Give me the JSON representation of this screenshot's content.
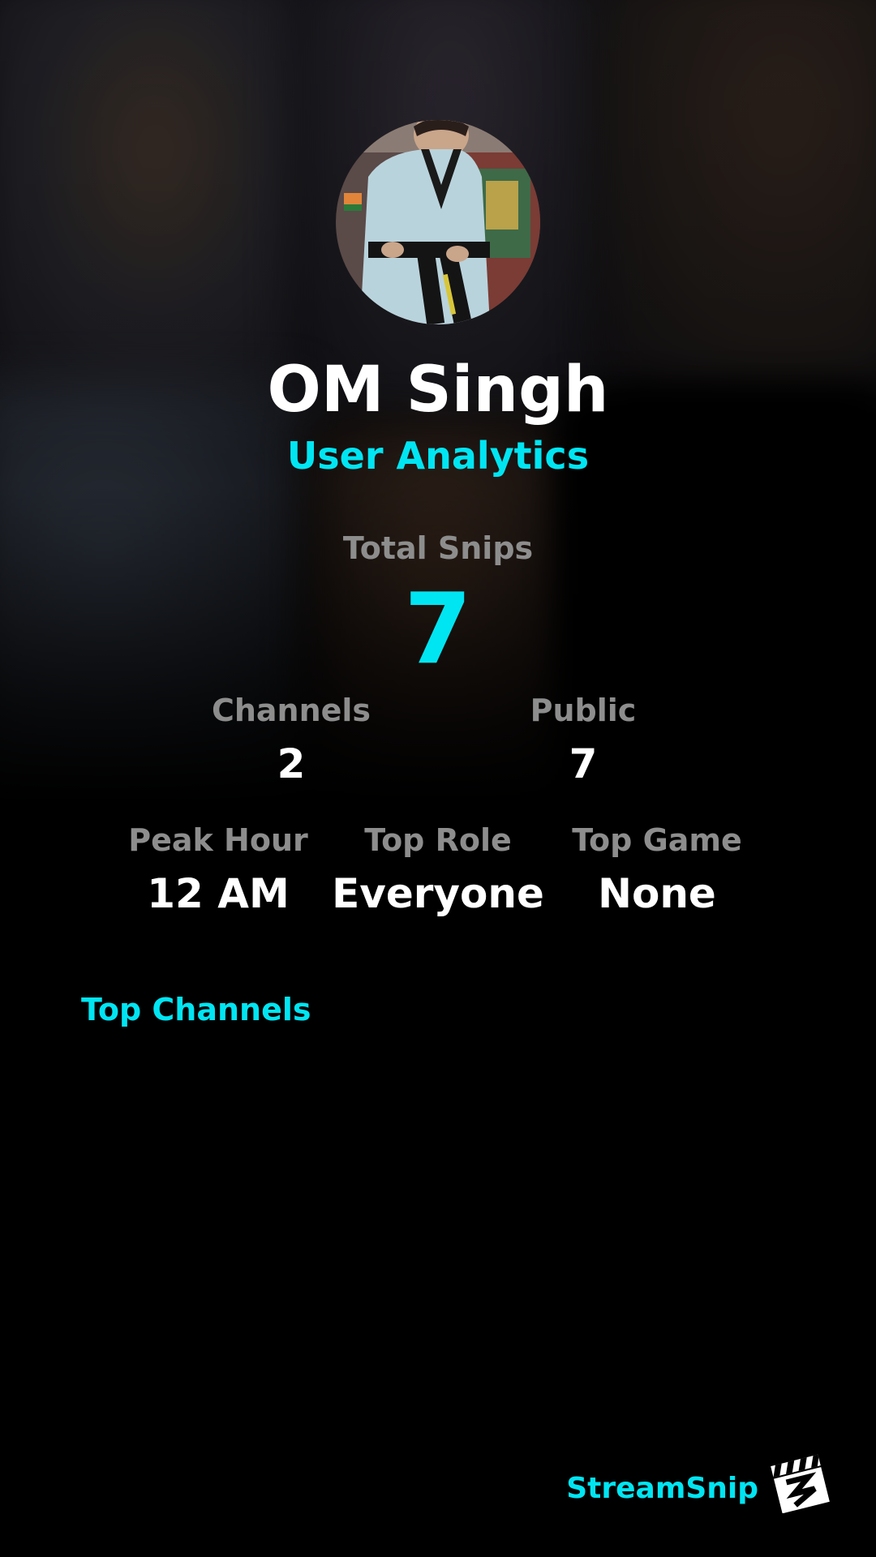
{
  "profile": {
    "name": "OM Singh",
    "subtitle": "User Analytics"
  },
  "stats": {
    "total_snips": {
      "label": "Total Snips",
      "value": "7"
    },
    "channels": {
      "label": "Channels",
      "value": "2"
    },
    "public": {
      "label": "Public",
      "value": "7"
    },
    "peak_hour": {
      "label": "Peak Hour",
      "value": "12 AM"
    },
    "top_role": {
      "label": "Top Role",
      "value": "Everyone"
    },
    "top_game": {
      "label": "Top Game",
      "value": "None"
    }
  },
  "sections": {
    "top_channels": "Top Channels"
  },
  "branding": {
    "name": "StreamSnip",
    "logo_icon": "clapperboard-icon"
  },
  "colors": {
    "accent": "#00e5f2",
    "label": "#8d8d8d",
    "value": "#ffffff",
    "background": "#000000"
  }
}
